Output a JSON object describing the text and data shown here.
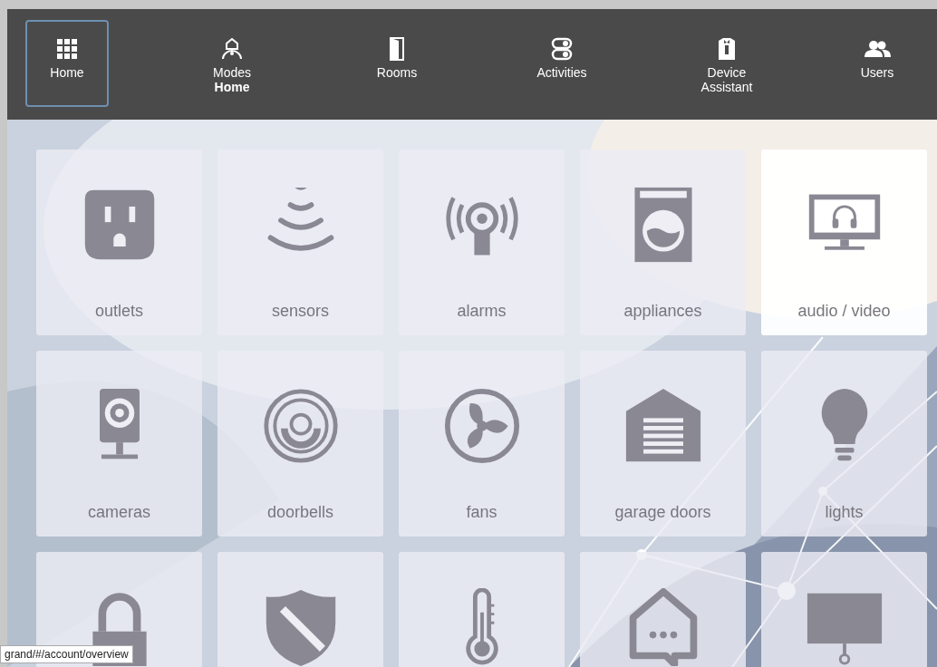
{
  "nav": [
    {
      "label": "Home",
      "selected": true
    },
    {
      "label": "Modes",
      "sublabel": "Home",
      "selected": false
    },
    {
      "label": "Rooms",
      "selected": false
    },
    {
      "label": "Activities",
      "selected": false
    },
    {
      "label": "Device Assistant",
      "selected": false
    },
    {
      "label": "Users",
      "selected": false
    }
  ],
  "tiles": [
    {
      "label": "outlets",
      "highlighted": false
    },
    {
      "label": "sensors",
      "highlighted": false
    },
    {
      "label": "alarms",
      "highlighted": false
    },
    {
      "label": "appliances",
      "highlighted": false
    },
    {
      "label": "audio / video",
      "highlighted": true
    },
    {
      "label": "cameras",
      "highlighted": false
    },
    {
      "label": "doorbells",
      "highlighted": false
    },
    {
      "label": "fans",
      "highlighted": false
    },
    {
      "label": "garage doors",
      "highlighted": false
    },
    {
      "label": "lights",
      "highlighted": false
    },
    {
      "highlighted": false
    },
    {
      "highlighted": false
    },
    {
      "highlighted": false
    },
    {
      "highlighted": false
    },
    {
      "highlighted": false
    }
  ],
  "status_url": "grand/#/account/overview"
}
